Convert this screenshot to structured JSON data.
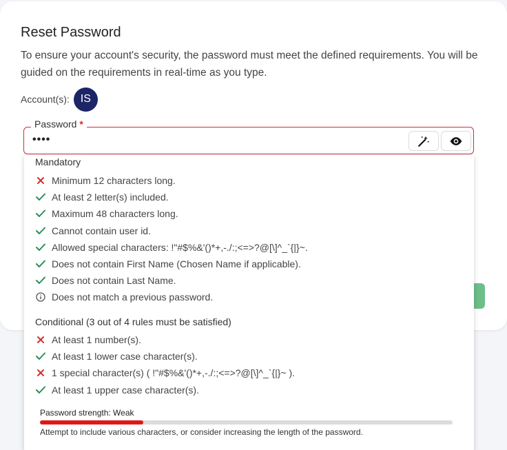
{
  "page": {
    "title": "Reset Password",
    "description": "To ensure your account's security, the password must meet the defined requirements. You will be guided on the requirements in real-time as you type.",
    "accounts_label": "Account(s):",
    "avatar_initials": "IS"
  },
  "password": {
    "label": "Password",
    "required_mark": "*",
    "masked_value": "••••",
    "generate_icon": "magic-wand-icon",
    "toggle_icon": "eye-icon"
  },
  "requirements": {
    "mandatory_title": "Mandatory",
    "mandatory": [
      {
        "text": "Minimum 12 characters long.",
        "status": "fail"
      },
      {
        "text": "At least 2 letter(s) included.",
        "status": "pass"
      },
      {
        "text": "Maximum 48 characters long.",
        "status": "pass"
      },
      {
        "text": "Cannot contain user id.",
        "status": "pass"
      },
      {
        "text": "Allowed special characters: !\"#$%&'()*+,-./:;<=>?@[\\]^_`{|}~.",
        "status": "pass"
      },
      {
        "text": "Does not contain First Name (Chosen Name if applicable).",
        "status": "pass"
      },
      {
        "text": "Does not contain Last Name.",
        "status": "pass"
      },
      {
        "text": "Does not match a previous password.",
        "status": "info"
      }
    ],
    "conditional_title": "Conditional (3 out of 4 rules must be satisfied)",
    "conditional": [
      {
        "text": "At least 1 number(s).",
        "status": "fail"
      },
      {
        "text": "At least 1 lower case character(s).",
        "status": "pass"
      },
      {
        "text": "1 special character(s) ( !\"#$%&'()*+,-./:;<=>?@[\\]^_`{|}~ ).",
        "status": "fail"
      },
      {
        "text": "At least 1 upper case character(s).",
        "status": "pass"
      }
    ]
  },
  "strength": {
    "label": "Password strength: Weak",
    "level": 0.25,
    "hint": "Attempt to include various characters, or consider increasing the length of the password."
  },
  "colors": {
    "pass": "#2e8b57",
    "fail": "#d32f2f",
    "info": "#555555",
    "avatar_bg": "#1d2566",
    "strength_fill": "#e01818",
    "field_border": "#c62f3b"
  }
}
